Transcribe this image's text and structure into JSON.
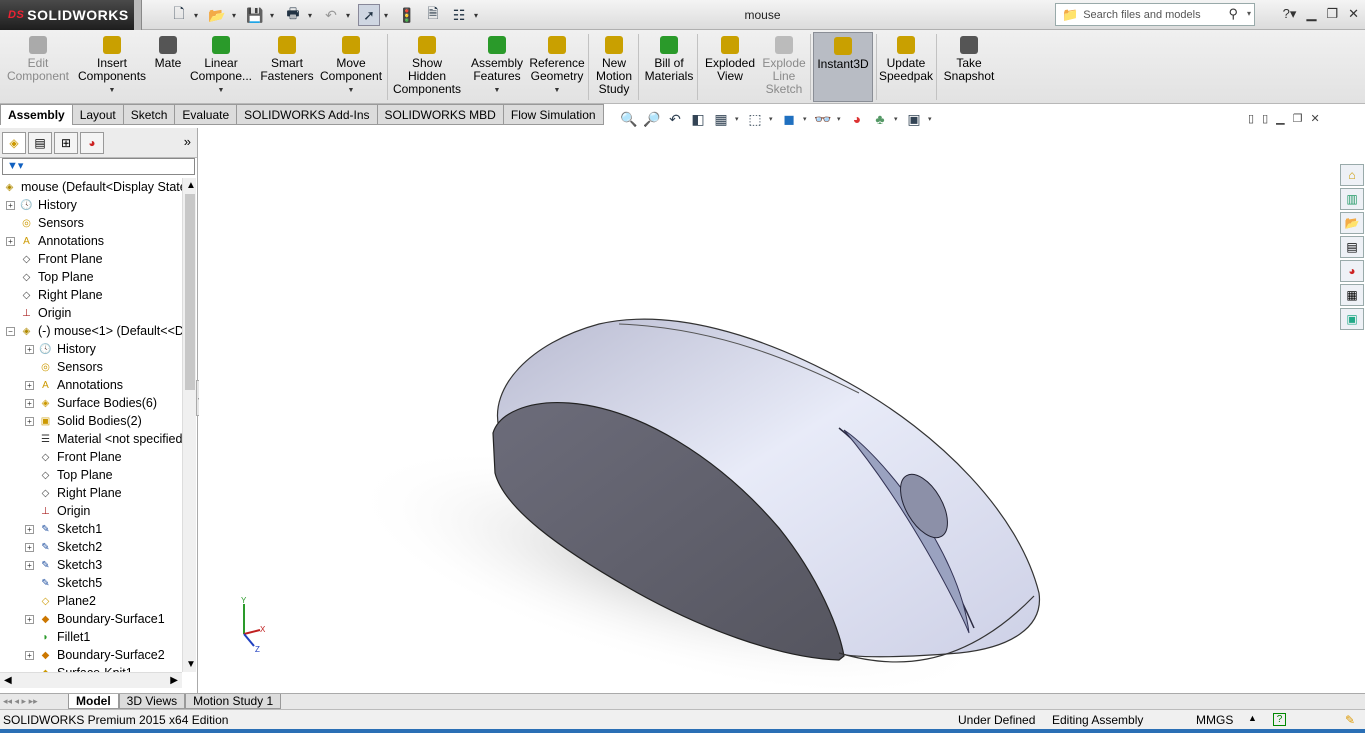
{
  "window": {
    "title": "mouse",
    "brand": "SOLIDWORKS",
    "search_placeholder": "Search files and models"
  },
  "ribbon": {
    "buttons": [
      {
        "label": "Edit\nComponent",
        "enabled": false
      },
      {
        "label": "Insert\nComponents",
        "enabled": true
      },
      {
        "label": "Mate",
        "enabled": true
      },
      {
        "label": "Linear\nCompone...",
        "enabled": true
      },
      {
        "label": "Smart\nFasteners",
        "enabled": true
      },
      {
        "label": "Move\nComponent",
        "enabled": true
      },
      {
        "label": "Show\nHidden\nComponents",
        "enabled": true
      },
      {
        "label": "Assembly\nFeatures",
        "enabled": true
      },
      {
        "label": "Reference\nGeometry",
        "enabled": true
      },
      {
        "label": "New\nMotion\nStudy",
        "enabled": true
      },
      {
        "label": "Bill of\nMaterials",
        "enabled": true
      },
      {
        "label": "Exploded\nView",
        "enabled": true
      },
      {
        "label": "Explode\nLine\nSketch",
        "enabled": false
      },
      {
        "label": "Instant3D",
        "enabled": true,
        "active": true
      },
      {
        "label": "Update\nSpeedpak",
        "enabled": true
      },
      {
        "label": "Take\nSnapshot",
        "enabled": true
      }
    ]
  },
  "command_tabs": [
    "Assembly",
    "Layout",
    "Sketch",
    "Evaluate",
    "SOLIDWORKS Add-Ins",
    "SOLIDWORKS MBD",
    "Flow Simulation"
  ],
  "tree": {
    "root": "mouse  (Default<Display State",
    "items": [
      {
        "label": "History",
        "icon": "history-icon",
        "level": 0,
        "expand": true
      },
      {
        "label": "Sensors",
        "icon": "sensors-icon",
        "level": 0,
        "expand": false
      },
      {
        "label": "Annotations",
        "icon": "annotations-icon",
        "level": 0,
        "expand": true
      },
      {
        "label": "Front Plane",
        "icon": "plane-icon",
        "level": 0,
        "expand": false
      },
      {
        "label": "Top Plane",
        "icon": "plane-icon",
        "level": 0,
        "expand": false
      },
      {
        "label": "Right Plane",
        "icon": "plane-icon",
        "level": 0,
        "expand": false
      },
      {
        "label": "Origin",
        "icon": "origin-icon",
        "level": 0,
        "expand": false
      },
      {
        "label": "(-) mouse<1> (Default<<D",
        "icon": "part-icon",
        "level": 0,
        "expand": "minus"
      },
      {
        "label": "History",
        "icon": "history-icon",
        "level": 1,
        "expand": true
      },
      {
        "label": "Sensors",
        "icon": "sensors-icon",
        "level": 1,
        "expand": false
      },
      {
        "label": "Annotations",
        "icon": "annotations-icon",
        "level": 1,
        "expand": true
      },
      {
        "label": "Surface Bodies(6)",
        "icon": "surface-bodies-icon",
        "level": 1,
        "expand": true
      },
      {
        "label": "Solid Bodies(2)",
        "icon": "solid-bodies-icon",
        "level": 1,
        "expand": true
      },
      {
        "label": "Material <not specified",
        "icon": "material-icon",
        "level": 1,
        "expand": false
      },
      {
        "label": "Front Plane",
        "icon": "plane-icon",
        "level": 1,
        "expand": false
      },
      {
        "label": "Top Plane",
        "icon": "plane-icon",
        "level": 1,
        "expand": false
      },
      {
        "label": "Right Plane",
        "icon": "plane-icon",
        "level": 1,
        "expand": false
      },
      {
        "label": "Origin",
        "icon": "origin-icon",
        "level": 1,
        "expand": false
      },
      {
        "label": "Sketch1",
        "icon": "sketch-icon",
        "level": 1,
        "expand": true
      },
      {
        "label": "Sketch2",
        "icon": "sketch-icon",
        "level": 1,
        "expand": true
      },
      {
        "label": "Sketch3",
        "icon": "sketch-icon",
        "level": 1,
        "expand": true
      },
      {
        "label": "Sketch5",
        "icon": "sketch-icon",
        "level": 1,
        "expand": false
      },
      {
        "label": "Plane2",
        "icon": "plane2-icon",
        "level": 1,
        "expand": false
      },
      {
        "label": "Boundary-Surface1",
        "icon": "boundary-surface-icon",
        "level": 1,
        "expand": true
      },
      {
        "label": "Fillet1",
        "icon": "fillet-icon",
        "level": 1,
        "expand": false
      },
      {
        "label": "Boundary-Surface2",
        "icon": "boundary-surface-icon",
        "level": 1,
        "expand": true
      },
      {
        "label": "Surface-Knit1",
        "icon": "surface-knit-icon",
        "level": 1,
        "expand": false
      }
    ]
  },
  "bottom_tabs": [
    "Model",
    "3D Views",
    "Motion Study 1"
  ],
  "status": {
    "edition": "SOLIDWORKS Premium 2015 x64 Edition",
    "state": "Under Defined",
    "mode": "Editing Assembly",
    "units": "MMGS"
  },
  "triad": {
    "x": "X",
    "y": "Y",
    "z": "Z"
  }
}
